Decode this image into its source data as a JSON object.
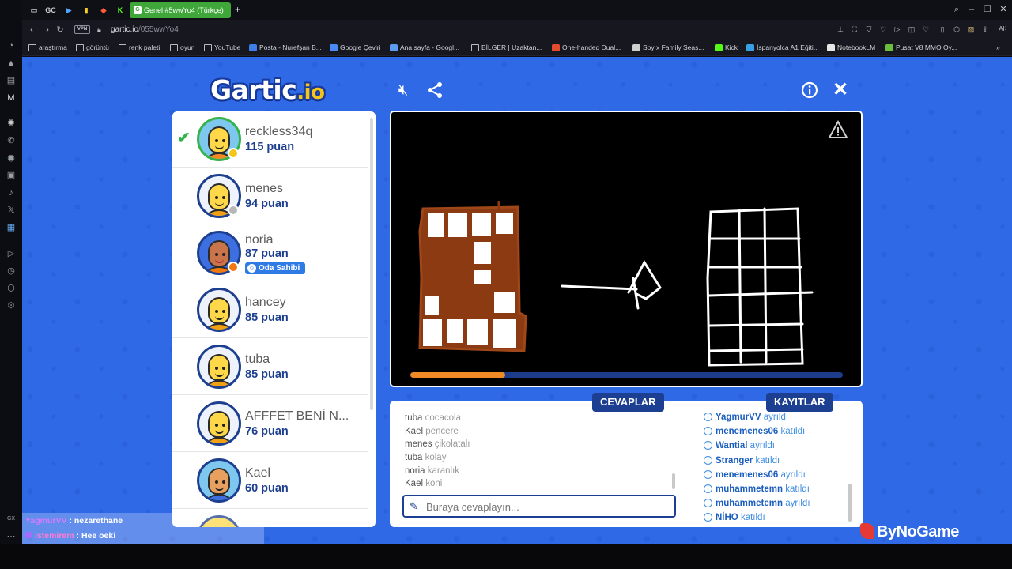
{
  "browser": {
    "active_tab_title": "Genel #5wwYo4 (Türkçe)",
    "url_host": "gartic.io",
    "url_path": "/055wwYo4",
    "vpn_label": "VPN",
    "pinned_tabs": [
      "GC"
    ],
    "bookmarks": [
      "araştırma",
      "görüntü",
      "renk paleti",
      "oyun",
      "YouTube",
      "Posta - Nurefşan B...",
      "Google Çeviri",
      "Ana sayfa - Googl...",
      "BİLGER | Uzaktan...",
      "One-handed Dual...",
      "Spy x Family Seas...",
      "Kick",
      "İspanyolca A1 Eğiti...",
      "NotebookLM",
      "Pusat V8 MMO Oy..."
    ],
    "ai_label": "AI"
  },
  "game": {
    "logo_text": "Gartic",
    "logo_suffix": ".io",
    "timer_progress": 0.22,
    "answers_tab": "CEVAPLAR",
    "logs_tab": "KAYITLAR",
    "input_placeholder": "Buraya cevaplayın...",
    "owner_badge": "Oda Sahibi",
    "sponsor": "ByNoGame"
  },
  "players": [
    {
      "name": "reckless34q",
      "score": "115 puan",
      "guessed": true,
      "status_color": "#f5c518"
    },
    {
      "name": "menes",
      "score": "94 puan",
      "guessed": false,
      "status_color": "#b8b8b8"
    },
    {
      "name": "noria",
      "score": "87 puan",
      "guessed": false,
      "status_color": "#f07a10",
      "owner": true
    },
    {
      "name": "hancey",
      "score": "85 puan",
      "guessed": false
    },
    {
      "name": "tuba",
      "score": "85 puan",
      "guessed": false
    },
    {
      "name": "AFFFET BENİ N...",
      "score": "76 puan",
      "guessed": false
    },
    {
      "name": "Kael",
      "score": "60 puan",
      "guessed": false
    }
  ],
  "answers": [
    {
      "user": "tuba",
      "text": "cocacola"
    },
    {
      "user": "Kael",
      "text": "pencere"
    },
    {
      "user": "menes",
      "text": "çikolatalı"
    },
    {
      "user": "tuba",
      "text": "kolay"
    },
    {
      "user": "noria",
      "text": "karanlık"
    },
    {
      "user": "Kael",
      "text": "koni"
    }
  ],
  "logs": [
    {
      "user": "YagmurVV",
      "action": "ayrıldı"
    },
    {
      "user": "menemenes06",
      "action": "katıldı"
    },
    {
      "user": "Wantial",
      "action": "ayrıldı"
    },
    {
      "user": "Stranger",
      "action": "katıldı"
    },
    {
      "user": "menemenes06",
      "action": "ayrıldı"
    },
    {
      "user": "muhammetemn",
      "action": "katıldı"
    },
    {
      "user": "muhammetemn",
      "action": "ayrıldı"
    },
    {
      "user": "NİHO",
      "action": "katıldı"
    }
  ],
  "stream_chat": [
    {
      "user": "YagmurVV",
      "sep": " : ",
      "text": "nezarethane"
    },
    {
      "user": "istemirem",
      "sep": " : ",
      "text": "Hee oeki"
    }
  ],
  "colors": {
    "game_bg": "#2f69e6",
    "navy": "#1c3f91",
    "timer": "#f08a24",
    "brown": "#8b3a12"
  }
}
